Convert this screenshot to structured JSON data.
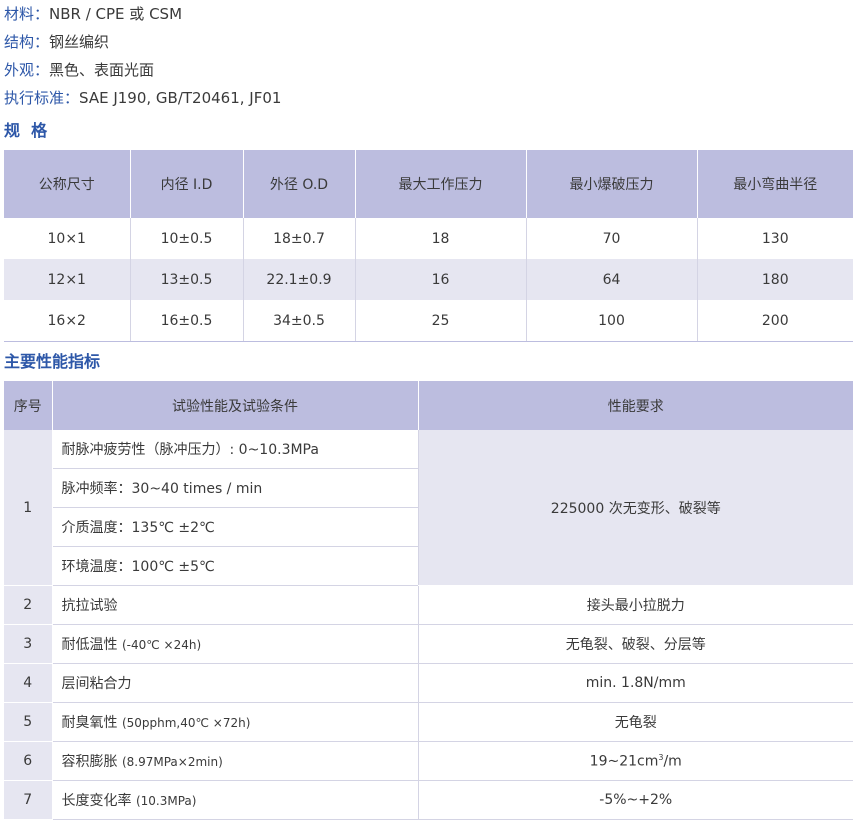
{
  "attrs": [
    {
      "key": "材料：",
      "value": "NBR / CPE 或 CSM"
    },
    {
      "key": "结构：",
      "value": "钢丝编织"
    },
    {
      "key": "外观：",
      "value": "黑色、表面光面"
    },
    {
      "key": "执行标准：",
      "value": "SAE J190, GB/T20461, JF01"
    }
  ],
  "spec_title": "规  格",
  "spec": {
    "headers": [
      "公称尺寸",
      "内径 I.D",
      "外径 O.D",
      "最大工作压力",
      "最小爆破压力",
      "最小弯曲半径"
    ],
    "rows": [
      [
        "10×1",
        "10±0.5",
        "18±0.7",
        "18",
        "70",
        "130"
      ],
      [
        "12×1",
        "13±0.5",
        "22.1±0.9",
        "16",
        "64",
        "180"
      ],
      [
        "16×2",
        "16±0.5",
        "34±0.5",
        "25",
        "100",
        "200"
      ]
    ]
  },
  "perf_title": "主要性能指标",
  "perf": {
    "headers": [
      "序号",
      "试验性能及试验条件",
      "性能要求"
    ],
    "row1": {
      "num": "1",
      "conditions": [
        "耐脉冲疲劳性（脉冲压力）: 0~10.3MPa",
        "脉冲频率：30~40 times / min",
        "介质温度：135℃ ±2℃",
        "环境温度：100℃ ±5℃"
      ],
      "requirement": "225000 次无变形、破裂等"
    },
    "rows": [
      {
        "num": "2",
        "cond": "抗拉试验",
        "cond_small": "",
        "req": "接头最小拉脱力"
      },
      {
        "num": "3",
        "cond": "耐低温性",
        "cond_small": "(-40℃ ×24h)",
        "req": "无龟裂、破裂、分层等"
      },
      {
        "num": "4",
        "cond": "层间粘合力",
        "cond_small": "",
        "req": "min. 1.8N/mm"
      },
      {
        "num": "5",
        "cond": "耐臭氧性",
        "cond_small": "(50pphm,40℃ ×72h)",
        "req": "无龟裂"
      },
      {
        "num": "6",
        "cond": "容积膨胀",
        "cond_small": "(8.97MPa×2min)",
        "req": "19~21cm",
        "req_sup": "3",
        "req_suffix": "/m"
      },
      {
        "num": "7",
        "cond": "长度变化率",
        "cond_small": "(10.3MPa)",
        "req": "-5%~+2%"
      }
    ]
  }
}
